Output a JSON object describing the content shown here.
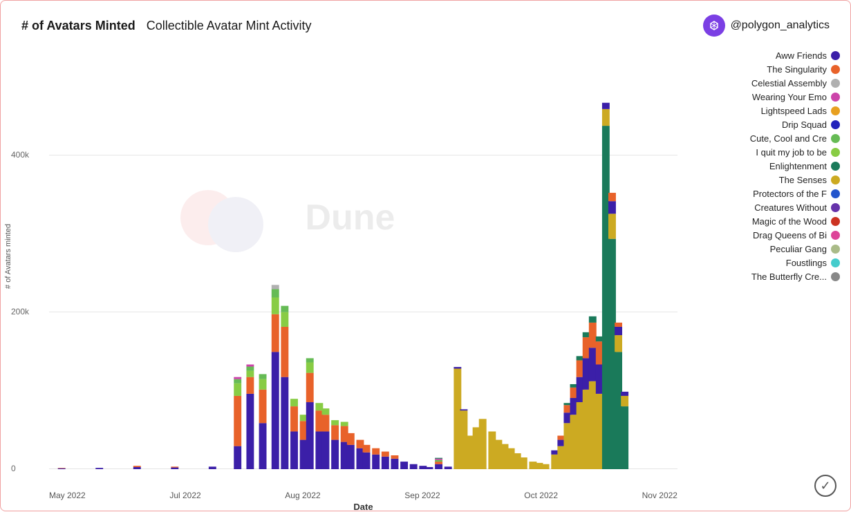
{
  "header": {
    "title_main": "# of Avatars Minted",
    "title_sub": "Collectible Avatar Mint Activity",
    "handle": "@polygon_analytics"
  },
  "yaxis": {
    "label": "# of Avatars minted",
    "ticks": [
      {
        "value": "400k",
        "pct": 75
      },
      {
        "value": "200k",
        "pct": 37.5
      },
      {
        "value": "0",
        "pct": 0
      }
    ]
  },
  "xaxis": {
    "title": "Date",
    "labels": [
      "May 2022",
      "Jul 2022",
      "Aug 2022",
      "Sep 2022",
      "Oct 2022",
      "Nov 2022"
    ]
  },
  "legend": [
    {
      "label": "Aww Friends",
      "color": "#3b1fa8"
    },
    {
      "label": "The Singularity",
      "color": "#e8622a"
    },
    {
      "label": "Celestial Assembly",
      "color": "#b0b0b0"
    },
    {
      "label": "Wearing Your Emo",
      "color": "#cc44aa"
    },
    {
      "label": "Lightspeed Lads",
      "color": "#e8a020"
    },
    {
      "label": "Drip Squad",
      "color": "#2222bb"
    },
    {
      "label": "Cute, Cool and Cre",
      "color": "#66bb55"
    },
    {
      "label": "I quit my job to be",
      "color": "#88cc44"
    },
    {
      "label": "Enlightenment",
      "color": "#1a7a5a"
    },
    {
      "label": "The Senses",
      "color": "#ccaa22"
    },
    {
      "label": "Protectors of the F",
      "color": "#2255cc"
    },
    {
      "label": "Creatures Without",
      "color": "#6633aa"
    },
    {
      "label": "Magic of the Wood",
      "color": "#cc3322"
    },
    {
      "label": "Drag Queens of Bi",
      "color": "#dd4499"
    },
    {
      "label": "Peculiar Gang",
      "color": "#aabb88"
    },
    {
      "label": "Foustlings",
      "color": "#44cccc"
    },
    {
      "label": "The Butterfly Cre...",
      "color": "#888888"
    }
  ],
  "watermark_text": "Dune",
  "checkmark": "✓",
  "bars": [
    {
      "x": 0.02,
      "segments": [
        {
          "color": "#3b1fa8",
          "h": 0.002
        },
        {
          "color": "#e8622a",
          "h": 0.001
        }
      ]
    },
    {
      "x": 0.08,
      "segments": [
        {
          "color": "#3b1fa8",
          "h": 0.003
        }
      ]
    },
    {
      "x": 0.14,
      "segments": [
        {
          "color": "#3b1fa8",
          "h": 0.005
        },
        {
          "color": "#e8622a",
          "h": 0.003
        }
      ]
    },
    {
      "x": 0.2,
      "segments": [
        {
          "color": "#3b1fa8",
          "h": 0.004
        },
        {
          "color": "#e8622a",
          "h": 0.002
        }
      ]
    },
    {
      "x": 0.26,
      "segments": [
        {
          "color": "#3b1fa8",
          "h": 0.006
        }
      ]
    },
    {
      "x": 0.3,
      "segments": [
        {
          "color": "#3b1fa8",
          "h": 0.055
        },
        {
          "color": "#e8622a",
          "h": 0.12
        },
        {
          "color": "#88cc44",
          "h": 0.03
        },
        {
          "color": "#66bb55",
          "h": 0.01
        },
        {
          "color": "#cc44aa",
          "h": 0.005
        }
      ]
    },
    {
      "x": 0.32,
      "segments": [
        {
          "color": "#3b1fa8",
          "h": 0.18
        },
        {
          "color": "#e8622a",
          "h": 0.04
        },
        {
          "color": "#88cc44",
          "h": 0.015
        },
        {
          "color": "#66bb55",
          "h": 0.01
        },
        {
          "color": "#cc44aa",
          "h": 0.005
        }
      ]
    },
    {
      "x": 0.34,
      "segments": [
        {
          "color": "#3b1fa8",
          "h": 0.11
        },
        {
          "color": "#e8622a",
          "h": 0.08
        },
        {
          "color": "#88cc44",
          "h": 0.025
        },
        {
          "color": "#66bb55",
          "h": 0.012
        }
      ]
    },
    {
      "x": 0.36,
      "segments": [
        {
          "color": "#3b1fa8",
          "h": 0.28
        },
        {
          "color": "#e8622a",
          "h": 0.09
        },
        {
          "color": "#88cc44",
          "h": 0.04
        },
        {
          "color": "#66bb55",
          "h": 0.02
        },
        {
          "color": "#b0b0b0",
          "h": 0.01
        }
      ]
    },
    {
      "x": 0.375,
      "segments": [
        {
          "color": "#3b1fa8",
          "h": 0.22
        },
        {
          "color": "#e8622a",
          "h": 0.12
        },
        {
          "color": "#88cc44",
          "h": 0.035
        },
        {
          "color": "#66bb55",
          "h": 0.015
        }
      ]
    },
    {
      "x": 0.39,
      "segments": [
        {
          "color": "#3b1fa8",
          "h": 0.09
        },
        {
          "color": "#e8622a",
          "h": 0.06
        },
        {
          "color": "#88cc44",
          "h": 0.018
        }
      ]
    },
    {
      "x": 0.405,
      "segments": [
        {
          "color": "#3b1fa8",
          "h": 0.07
        },
        {
          "color": "#e8622a",
          "h": 0.045
        },
        {
          "color": "#88cc44",
          "h": 0.015
        }
      ]
    },
    {
      "x": 0.415,
      "segments": [
        {
          "color": "#3b1fa8",
          "h": 0.16
        },
        {
          "color": "#e8622a",
          "h": 0.07
        },
        {
          "color": "#88cc44",
          "h": 0.025
        },
        {
          "color": "#66bb55",
          "h": 0.01
        }
      ]
    },
    {
      "x": 0.43,
      "segments": [
        {
          "color": "#3b1fa8",
          "h": 0.09
        },
        {
          "color": "#e8622a",
          "h": 0.05
        },
        {
          "color": "#88cc44",
          "h": 0.018
        }
      ]
    },
    {
      "x": 0.44,
      "segments": [
        {
          "color": "#3b1fa8",
          "h": 0.09
        },
        {
          "color": "#e8622a",
          "h": 0.04
        },
        {
          "color": "#88cc44",
          "h": 0.015
        }
      ]
    },
    {
      "x": 0.455,
      "segments": [
        {
          "color": "#3b1fa8",
          "h": 0.07
        },
        {
          "color": "#e8622a",
          "h": 0.035
        },
        {
          "color": "#88cc44",
          "h": 0.012
        }
      ]
    },
    {
      "x": 0.47,
      "segments": [
        {
          "color": "#3b1fa8",
          "h": 0.065
        },
        {
          "color": "#e8622a",
          "h": 0.038
        },
        {
          "color": "#88cc44",
          "h": 0.01
        }
      ]
    },
    {
      "x": 0.48,
      "segments": [
        {
          "color": "#3b1fa8",
          "h": 0.058
        },
        {
          "color": "#e8622a",
          "h": 0.028
        }
      ]
    },
    {
      "x": 0.495,
      "segments": [
        {
          "color": "#3b1fa8",
          "h": 0.05
        },
        {
          "color": "#e8622a",
          "h": 0.02
        }
      ]
    },
    {
      "x": 0.505,
      "segments": [
        {
          "color": "#3b1fa8",
          "h": 0.04
        },
        {
          "color": "#e8622a",
          "h": 0.018
        }
      ]
    },
    {
      "x": 0.52,
      "segments": [
        {
          "color": "#3b1fa8",
          "h": 0.035
        },
        {
          "color": "#e8622a",
          "h": 0.015
        }
      ]
    },
    {
      "x": 0.535,
      "segments": [
        {
          "color": "#3b1fa8",
          "h": 0.03
        },
        {
          "color": "#e8622a",
          "h": 0.012
        }
      ]
    },
    {
      "x": 0.55,
      "segments": [
        {
          "color": "#3b1fa8",
          "h": 0.025
        },
        {
          "color": "#e8622a",
          "h": 0.008
        }
      ]
    },
    {
      "x": 0.565,
      "segments": [
        {
          "color": "#3b1fa8",
          "h": 0.018
        }
      ]
    },
    {
      "x": 0.58,
      "segments": [
        {
          "color": "#3b1fa8",
          "h": 0.012
        }
      ]
    },
    {
      "x": 0.595,
      "segments": [
        {
          "color": "#3b1fa8",
          "h": 0.008
        }
      ]
    },
    {
      "x": 0.605,
      "segments": [
        {
          "color": "#3b1fa8",
          "h": 0.005
        }
      ]
    },
    {
      "x": 0.62,
      "segments": [
        {
          "color": "#3b1fa8",
          "h": 0.012
        },
        {
          "color": "#e8622a",
          "h": 0.006
        },
        {
          "color": "#66bb55",
          "h": 0.004
        },
        {
          "color": "#cc44aa",
          "h": 0.003
        },
        {
          "color": "#1a7a5a",
          "h": 0.002
        }
      ]
    },
    {
      "x": 0.635,
      "segments": [
        {
          "color": "#3b1fa8",
          "h": 0.006
        }
      ]
    },
    {
      "x": 0.65,
      "segments": [
        {
          "color": "#ccaa22",
          "h": 0.24
        },
        {
          "color": "#3b1fa8",
          "h": 0.004
        }
      ]
    },
    {
      "x": 0.66,
      "segments": [
        {
          "color": "#ccaa22",
          "h": 0.14
        },
        {
          "color": "#3b1fa8",
          "h": 0.003
        }
      ]
    },
    {
      "x": 0.67,
      "segments": [
        {
          "color": "#ccaa22",
          "h": 0.08
        }
      ]
    },
    {
      "x": 0.68,
      "segments": [
        {
          "color": "#ccaa22",
          "h": 0.1
        }
      ]
    },
    {
      "x": 0.69,
      "segments": [
        {
          "color": "#ccaa22",
          "h": 0.12
        }
      ]
    },
    {
      "x": 0.705,
      "segments": [
        {
          "color": "#ccaa22",
          "h": 0.09
        }
      ]
    },
    {
      "x": 0.715,
      "segments": [
        {
          "color": "#ccaa22",
          "h": 0.07
        }
      ]
    },
    {
      "x": 0.725,
      "segments": [
        {
          "color": "#ccaa22",
          "h": 0.06
        }
      ]
    },
    {
      "x": 0.735,
      "segments": [
        {
          "color": "#ccaa22",
          "h": 0.05
        }
      ]
    },
    {
      "x": 0.745,
      "segments": [
        {
          "color": "#ccaa22",
          "h": 0.038
        }
      ]
    },
    {
      "x": 0.755,
      "segments": [
        {
          "color": "#ccaa22",
          "h": 0.028
        }
      ]
    },
    {
      "x": 0.77,
      "segments": [
        {
          "color": "#ccaa22",
          "h": 0.018
        }
      ]
    },
    {
      "x": 0.78,
      "segments": [
        {
          "color": "#ccaa22",
          "h": 0.015
        }
      ]
    },
    {
      "x": 0.79,
      "segments": [
        {
          "color": "#ccaa22",
          "h": 0.012
        }
      ]
    },
    {
      "x": 0.805,
      "segments": [
        {
          "color": "#ccaa22",
          "h": 0.035
        },
        {
          "color": "#3b1fa8",
          "h": 0.01
        }
      ]
    },
    {
      "x": 0.815,
      "segments": [
        {
          "color": "#ccaa22",
          "h": 0.055
        },
        {
          "color": "#3b1fa8",
          "h": 0.015
        },
        {
          "color": "#e8622a",
          "h": 0.01
        }
      ]
    },
    {
      "x": 0.825,
      "segments": [
        {
          "color": "#ccaa22",
          "h": 0.11
        },
        {
          "color": "#3b1fa8",
          "h": 0.025
        },
        {
          "color": "#e8622a",
          "h": 0.018
        },
        {
          "color": "#1a7a5a",
          "h": 0.005
        }
      ]
    },
    {
      "x": 0.835,
      "segments": [
        {
          "color": "#ccaa22",
          "h": 0.13
        },
        {
          "color": "#3b1fa8",
          "h": 0.04
        },
        {
          "color": "#e8622a",
          "h": 0.025
        },
        {
          "color": "#1a7a5a",
          "h": 0.008
        }
      ]
    },
    {
      "x": 0.845,
      "segments": [
        {
          "color": "#ccaa22",
          "h": 0.16
        },
        {
          "color": "#3b1fa8",
          "h": 0.06
        },
        {
          "color": "#e8622a",
          "h": 0.04
        },
        {
          "color": "#1a7a5a",
          "h": 0.01
        }
      ]
    },
    {
      "x": 0.855,
      "segments": [
        {
          "color": "#ccaa22",
          "h": 0.19
        },
        {
          "color": "#3b1fa8",
          "h": 0.075
        },
        {
          "color": "#e8622a",
          "h": 0.05
        },
        {
          "color": "#1a7a5a",
          "h": 0.012
        }
      ]
    },
    {
      "x": 0.865,
      "segments": [
        {
          "color": "#ccaa22",
          "h": 0.21
        },
        {
          "color": "#3b1fa8",
          "h": 0.08
        },
        {
          "color": "#e8622a",
          "h": 0.06
        },
        {
          "color": "#1a7a5a",
          "h": 0.015
        }
      ]
    },
    {
      "x": 0.876,
      "segments": [
        {
          "color": "#ccaa22",
          "h": 0.18
        },
        {
          "color": "#3b1fa8",
          "h": 0.07
        },
        {
          "color": "#e8622a",
          "h": 0.055
        },
        {
          "color": "#1a7a5a",
          "h": 0.012
        }
      ]
    },
    {
      "x": 0.886,
      "segments": [
        {
          "color": "#1a7a5a",
          "h": 0.82
        },
        {
          "color": "#ccaa22",
          "h": 0.04
        },
        {
          "color": "#3b1fa8",
          "h": 0.015
        }
      ]
    },
    {
      "x": 0.896,
      "segments": [
        {
          "color": "#1a7a5a",
          "h": 0.55
        },
        {
          "color": "#ccaa22",
          "h": 0.06
        },
        {
          "color": "#3b1fa8",
          "h": 0.03
        },
        {
          "color": "#e8622a",
          "h": 0.02
        }
      ]
    },
    {
      "x": 0.906,
      "segments": [
        {
          "color": "#1a7a5a",
          "h": 0.28
        },
        {
          "color": "#ccaa22",
          "h": 0.04
        },
        {
          "color": "#3b1fa8",
          "h": 0.02
        },
        {
          "color": "#e8622a",
          "h": 0.01
        }
      ]
    },
    {
      "x": 0.916,
      "segments": [
        {
          "color": "#1a7a5a",
          "h": 0.15
        },
        {
          "color": "#ccaa22",
          "h": 0.025
        },
        {
          "color": "#3b1fa8",
          "h": 0.01
        }
      ]
    }
  ]
}
